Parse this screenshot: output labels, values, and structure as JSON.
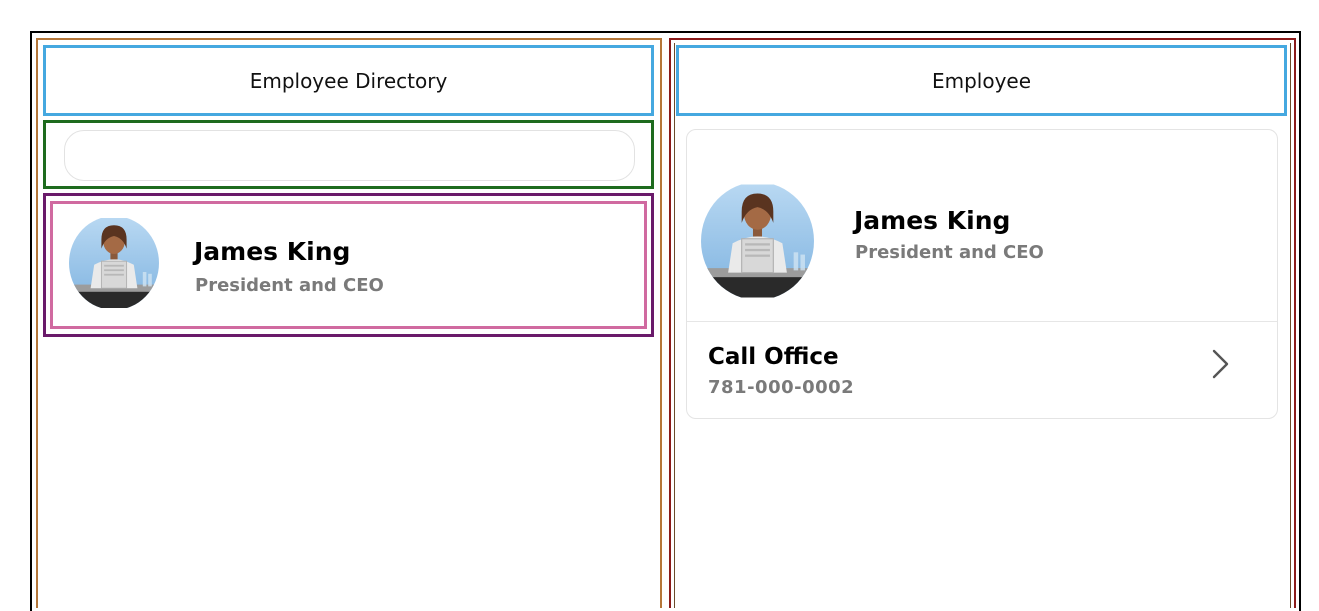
{
  "left_panel": {
    "header_title": "Employee Directory",
    "search": {
      "value": "",
      "placeholder": ""
    },
    "employees": [
      {
        "name": "James King",
        "title": "President and CEO",
        "avatar": "person-avatar"
      }
    ]
  },
  "right_panel": {
    "header_title": "Employee",
    "employee": {
      "name": "James King",
      "title": "President and CEO",
      "avatar": "person-avatar"
    },
    "actions": [
      {
        "label": "Call Office",
        "value": "781-000-0002",
        "icon": "chevron-right-icon"
      }
    ]
  },
  "colors": {
    "outer_frame": "#000000",
    "left_pane_border": "#b5773a",
    "right_pane_border": "#8b1a1a",
    "header_border": "#45a8e0",
    "search_border": "#1e6b1e",
    "list_outer_border": "#6a1a6a",
    "list_item_border": "#d06aa0",
    "secondary_text": "#7a7a7a"
  }
}
